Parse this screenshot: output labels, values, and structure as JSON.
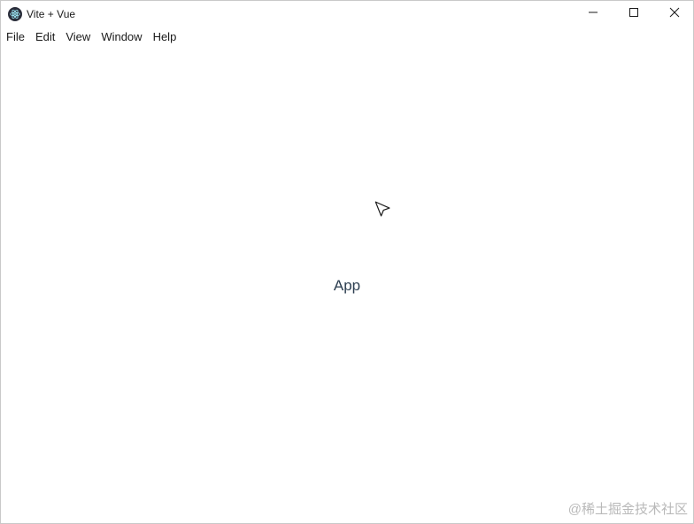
{
  "window": {
    "title": "Vite + Vue",
    "app_icon": "electron-icon",
    "controls": {
      "minimize_icon": "minimize-icon",
      "maximize_icon": "maximize-icon",
      "close_icon": "close-icon"
    }
  },
  "menubar": {
    "items": [
      {
        "label": "File"
      },
      {
        "label": "Edit"
      },
      {
        "label": "View"
      },
      {
        "label": "Window"
      },
      {
        "label": "Help"
      }
    ]
  },
  "main": {
    "app_text": "App",
    "text_color": "#2c3e50"
  },
  "watermark": {
    "text": "@稀土掘金技术社区"
  }
}
